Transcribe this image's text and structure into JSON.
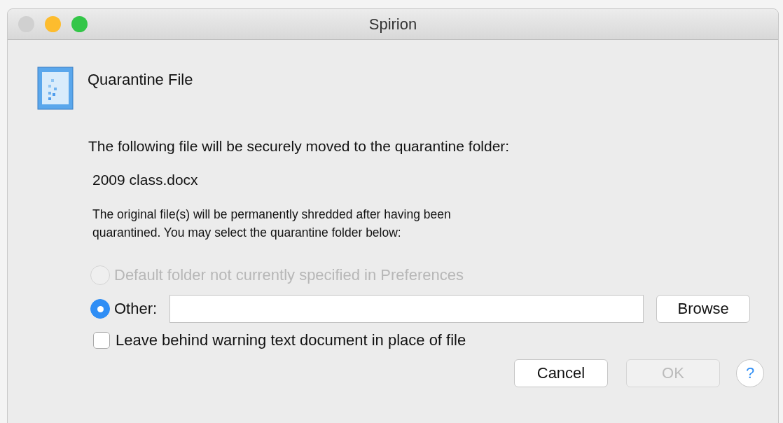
{
  "window": {
    "title": "Spirion"
  },
  "traffic_lights": [
    {
      "color": "#d0d0d0"
    },
    {
      "color": "#fdbc2e"
    },
    {
      "color": "#33c648"
    }
  ],
  "heading": "Quarantine File",
  "intro": "The following file will be securely moved to the quarantine folder:",
  "file_name": "2009 class.docx",
  "note": "The original file(s) will be permanently shredded after having been quarantined.  You may select the quarantine folder below:",
  "options": [
    {
      "label": "Default folder not currently specified in Preferences",
      "selected": false,
      "disabled": true
    },
    {
      "label": "Other:",
      "selected": true,
      "disabled": false
    }
  ],
  "browse_button": "Browse",
  "leave_warning": {
    "label": "Leave behind warning text document in place of file",
    "checked": false
  },
  "buttons": [
    {
      "label": "Cancel",
      "disabled": false
    },
    {
      "label": "OK",
      "disabled": true
    }
  ],
  "help_button": "?"
}
